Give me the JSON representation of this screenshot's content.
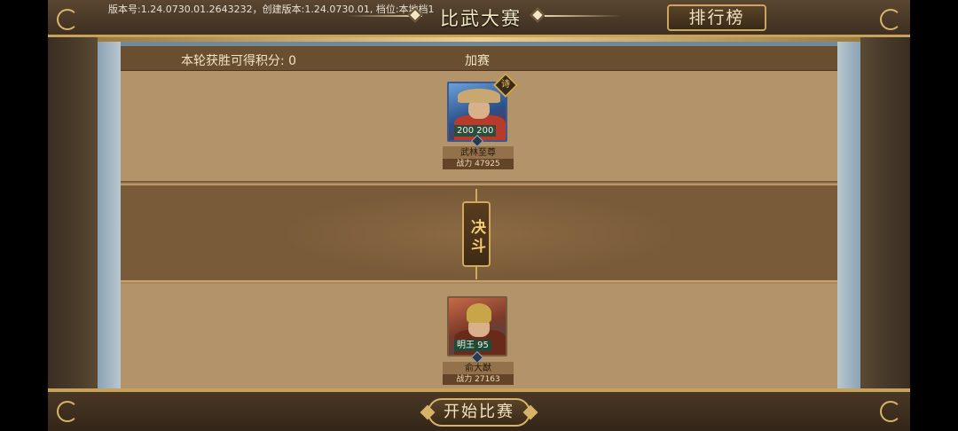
{
  "version_info": "版本号:1.24.0730.01.2643232，创建版本:1.24.0730.01, 档位:本地档1",
  "title": "比武大赛",
  "rank_button": "排行榜",
  "header": {
    "score_label": "本轮获胜可得积分: 0",
    "round_label": "加赛"
  },
  "duel_label": "决斗",
  "opponent": {
    "name": "武林至尊",
    "power": "战力 47925",
    "level_text": "200  200",
    "badge": "诗",
    "icon": "straw-hat-warrior-portrait"
  },
  "player": {
    "name": "俞大猷",
    "power": "战力 27163",
    "level_text": "明王 95",
    "icon": "armored-general-portrait"
  },
  "start_button": "开始比赛",
  "colors": {
    "frame": "#4b3c2b",
    "gold_trim": "#c8a25a",
    "paper": "#b2936a",
    "duel_band": "#7a5b39"
  }
}
